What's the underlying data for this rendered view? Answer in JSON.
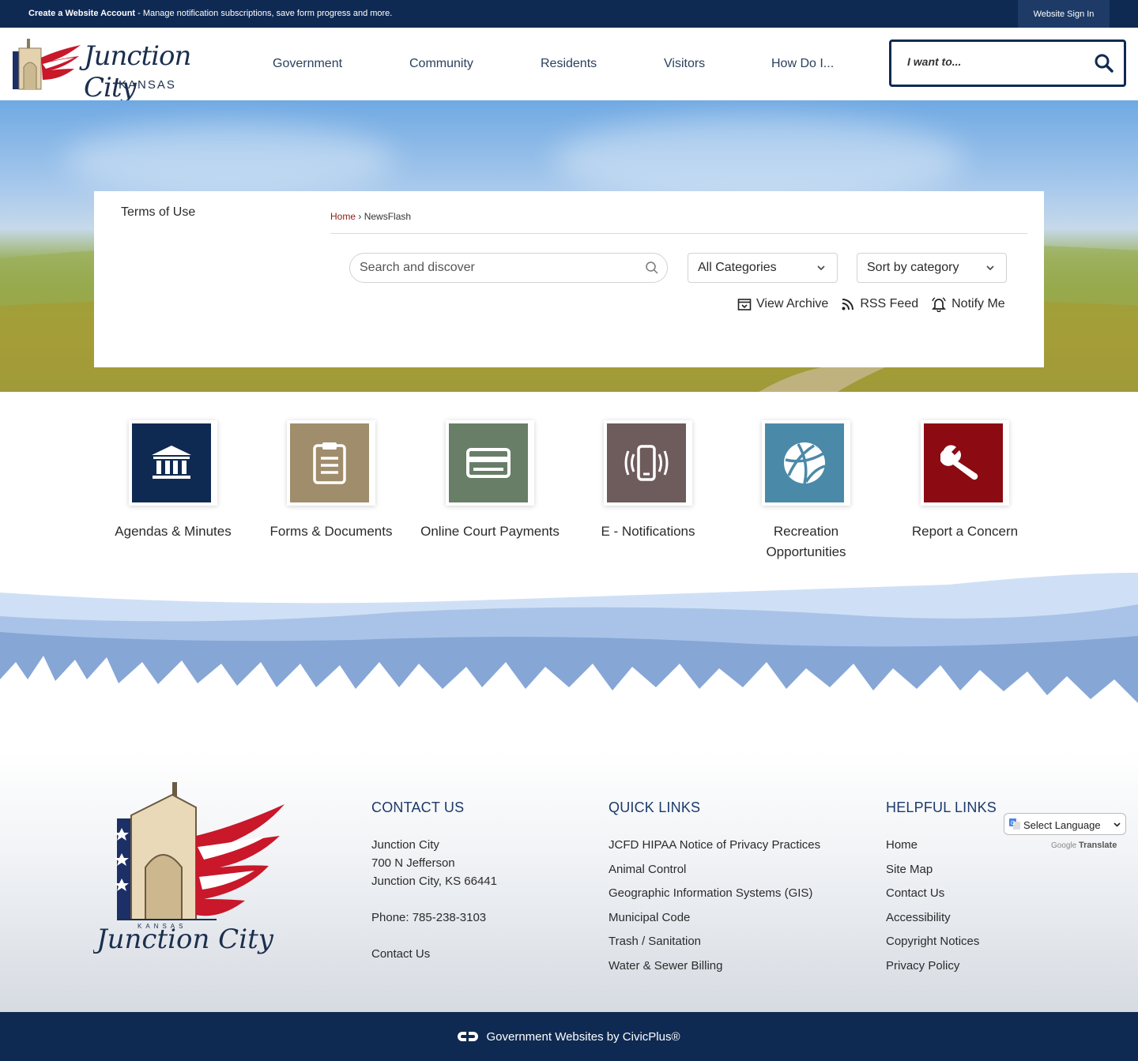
{
  "topbar": {
    "account_link": "Create a Website Account",
    "account_desc": " - Manage notification subscriptions, save form progress and more.",
    "sign_in": "Website Sign In"
  },
  "header": {
    "logo_script": "Junction City",
    "logo_state": "KANSAS",
    "nav": [
      "Government",
      "Community",
      "Residents",
      "Visitors",
      "How Do I..."
    ],
    "search_placeholder": "I want to...",
    "search_icon": "search-icon"
  },
  "panel": {
    "side_link": "Terms of Use",
    "breadcrumb": {
      "home": "Home",
      "separator": "›",
      "current": "NewsFlash"
    },
    "search_placeholder": "Search and discover",
    "category_select": "All Categories",
    "sort_select": "Sort by category",
    "actions": [
      {
        "label": "View Archive",
        "icon": "archive-icon"
      },
      {
        "label": "RSS Feed",
        "icon": "rss-icon"
      },
      {
        "label": "Notify Me",
        "icon": "bell-icon"
      }
    ]
  },
  "tiles": [
    {
      "label": "Agendas & Minutes",
      "icon": "government-building-icon",
      "color": "#0f2a52"
    },
    {
      "label": "Forms & Documents",
      "icon": "clipboard-icon",
      "color": "#a08d6c"
    },
    {
      "label": "Online Court Payments",
      "icon": "credit-card-icon",
      "color": "#687e67"
    },
    {
      "label": "E - Notifications",
      "icon": "phone-vibrate-icon",
      "color": "#6e5b5c"
    },
    {
      "label": "Recreation Opportunities",
      "icon": "basketball-icon",
      "color": "#4b89a8"
    },
    {
      "label": "Report a Concern",
      "icon": "wrench-icon",
      "color": "#8c0a12"
    }
  ],
  "footer": {
    "logo_state": "KANSAS",
    "logo_script": "Junction City",
    "contact": {
      "heading": "CONTACT US",
      "name": "Junction City",
      "street": "700 N Jefferson",
      "city": "Junction City, KS 66441",
      "phone": "Phone: 785-238-3103",
      "link": "Contact Us"
    },
    "quick_links": {
      "heading": "QUICK LINKS",
      "items": [
        "JCFD HIPAA Notice of Privacy Practices",
        "Animal Control",
        "Geographic Information Systems (GIS)",
        "Municipal Code",
        "Trash / Sanitation",
        "Water & Sewer Billing"
      ]
    },
    "helpful_links": {
      "heading": "HELPFUL LINKS",
      "items": [
        "Home",
        "Site Map",
        "Contact Us",
        "Accessibility",
        "Copyright Notices",
        "Privacy Policy"
      ]
    },
    "translate": {
      "select_label": "Select Language",
      "powered_by": "Google",
      "translate_word": "Translate"
    }
  },
  "bottom": {
    "credit": "Government Websites by CivicPlus®"
  },
  "colors": {
    "navy": "#0f2a52",
    "link_red": "#8c1c13",
    "heading_blue": "#1b3a6b"
  }
}
